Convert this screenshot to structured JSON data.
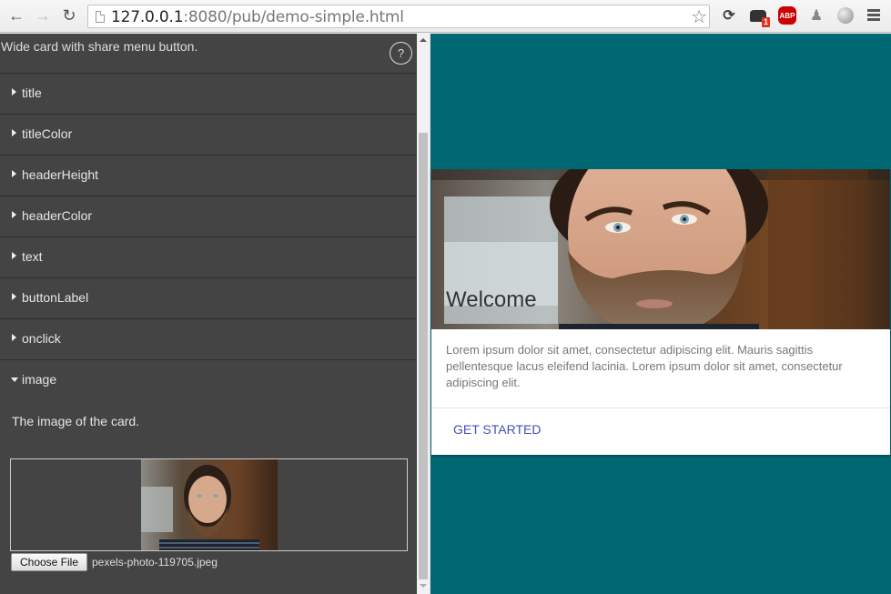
{
  "browser": {
    "url_host": "127.0.0.1",
    "url_rest": ":8080/pub/demo-simple.html",
    "extensions": [
      {
        "name": "sync-icon"
      },
      {
        "name": "ghostery-icon",
        "badge": "1"
      },
      {
        "name": "adblock-plus-icon",
        "label": "ABP"
      },
      {
        "name": "puzzle-icon"
      },
      {
        "name": "globe-icon"
      }
    ]
  },
  "panel": {
    "description": "Wide card with share menu button.",
    "help_label": "?",
    "properties": [
      {
        "label": "title",
        "expanded": false
      },
      {
        "label": "titleColor",
        "expanded": false
      },
      {
        "label": "headerHeight",
        "expanded": false
      },
      {
        "label": "headerColor",
        "expanded": false
      },
      {
        "label": "text",
        "expanded": false
      },
      {
        "label": "buttonLabel",
        "expanded": false
      },
      {
        "label": "onclick",
        "expanded": false
      },
      {
        "label": "image",
        "expanded": true
      }
    ],
    "image_property": {
      "description": "The image of the card.",
      "choose_file_label": "Choose File",
      "file_name": "pexels-photo-119705.jpeg"
    }
  },
  "preview": {
    "background_color": "#006872",
    "card": {
      "title": "Welcome",
      "text": "Lorem ipsum dolor sit amet, consectetur adipiscing elit. Mauris sagittis pellentesque lacus eleifend lacinia. Lorem ipsum dolor sit amet, consectetur adipiscing elit.",
      "button_label": "GET STARTED",
      "button_color": "#3f51b5"
    }
  }
}
